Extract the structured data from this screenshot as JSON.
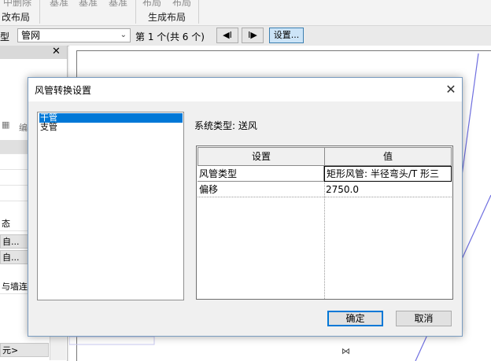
{
  "ribbon": {
    "top_items": [
      "中删除",
      "基准",
      "基准",
      "基准",
      "布局",
      "布局"
    ],
    "panel_left": "改布局",
    "panel_right": "生成布局"
  },
  "optionsbar": {
    "type_label": "型",
    "type_value": "管网",
    "count_text": "第 1 个(共 6 个)",
    "prev_label": "◀I",
    "next_label": "I▶",
    "settings_label": "设置..."
  },
  "left_panel": {
    "close_glyph": "✕",
    "edit_label": "编",
    "rows": [
      "态",
      "自...",
      "自...",
      "与墙连接",
      "元>"
    ]
  },
  "dialog": {
    "title": "风管转换设置",
    "list_items": [
      "干管",
      "支管"
    ],
    "system_type_label": "系统类型: 送风",
    "grid": {
      "headers": [
        "设置",
        "值"
      ],
      "rows": [
        {
          "name": "风管类型",
          "value": "矩形风管: 半径弯头/T 形三"
        },
        {
          "name": "偏移",
          "value": "2750.0"
        }
      ]
    },
    "ok_label": "确定",
    "cancel_label": "取消"
  },
  "colors": {
    "selection": "#0078d7",
    "canvas_line": "#6f6fe0"
  },
  "icons": {
    "close": "close-icon",
    "dialog_close": "close-icon",
    "dropdown": "chevron-down-icon",
    "edit": "edit-icon"
  }
}
